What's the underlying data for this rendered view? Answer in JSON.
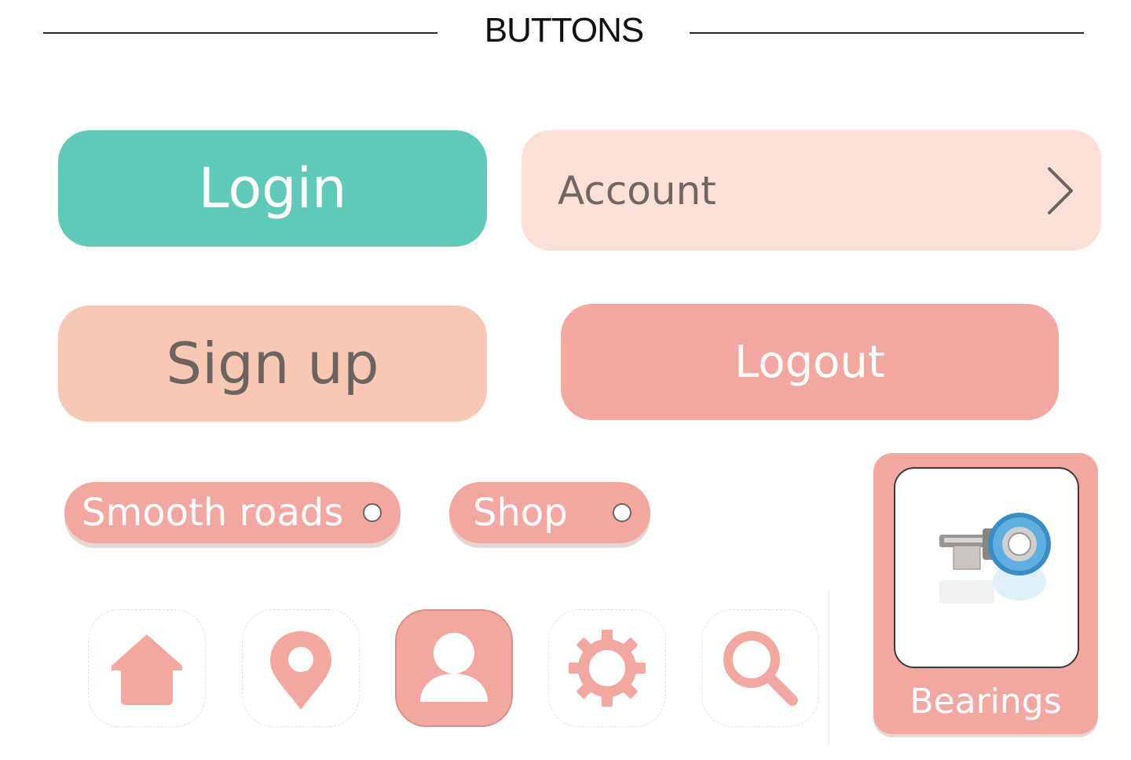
{
  "header": {
    "title": "BUTTONS"
  },
  "buttons": {
    "login": "Login",
    "account": "Account",
    "signup": "Sign up",
    "logout": "Logout"
  },
  "pills": [
    {
      "label": "Smooth roads"
    },
    {
      "label": "Shop"
    }
  ],
  "icon_buttons": [
    {
      "icon": "home-icon",
      "active": false
    },
    {
      "icon": "map-pin-icon",
      "active": false
    },
    {
      "icon": "user-icon",
      "active": true
    },
    {
      "icon": "gear-icon",
      "active": false
    },
    {
      "icon": "search-icon",
      "active": false
    }
  ],
  "product_card": {
    "label": "Bearings",
    "image": "skateboard bearings"
  },
  "colors": {
    "teal": "#5ecab7",
    "salmon": "#f2a7a0",
    "peach": "#f6c8b5",
    "blush": "#fbe0d7",
    "text_gray": "#6b6461"
  }
}
